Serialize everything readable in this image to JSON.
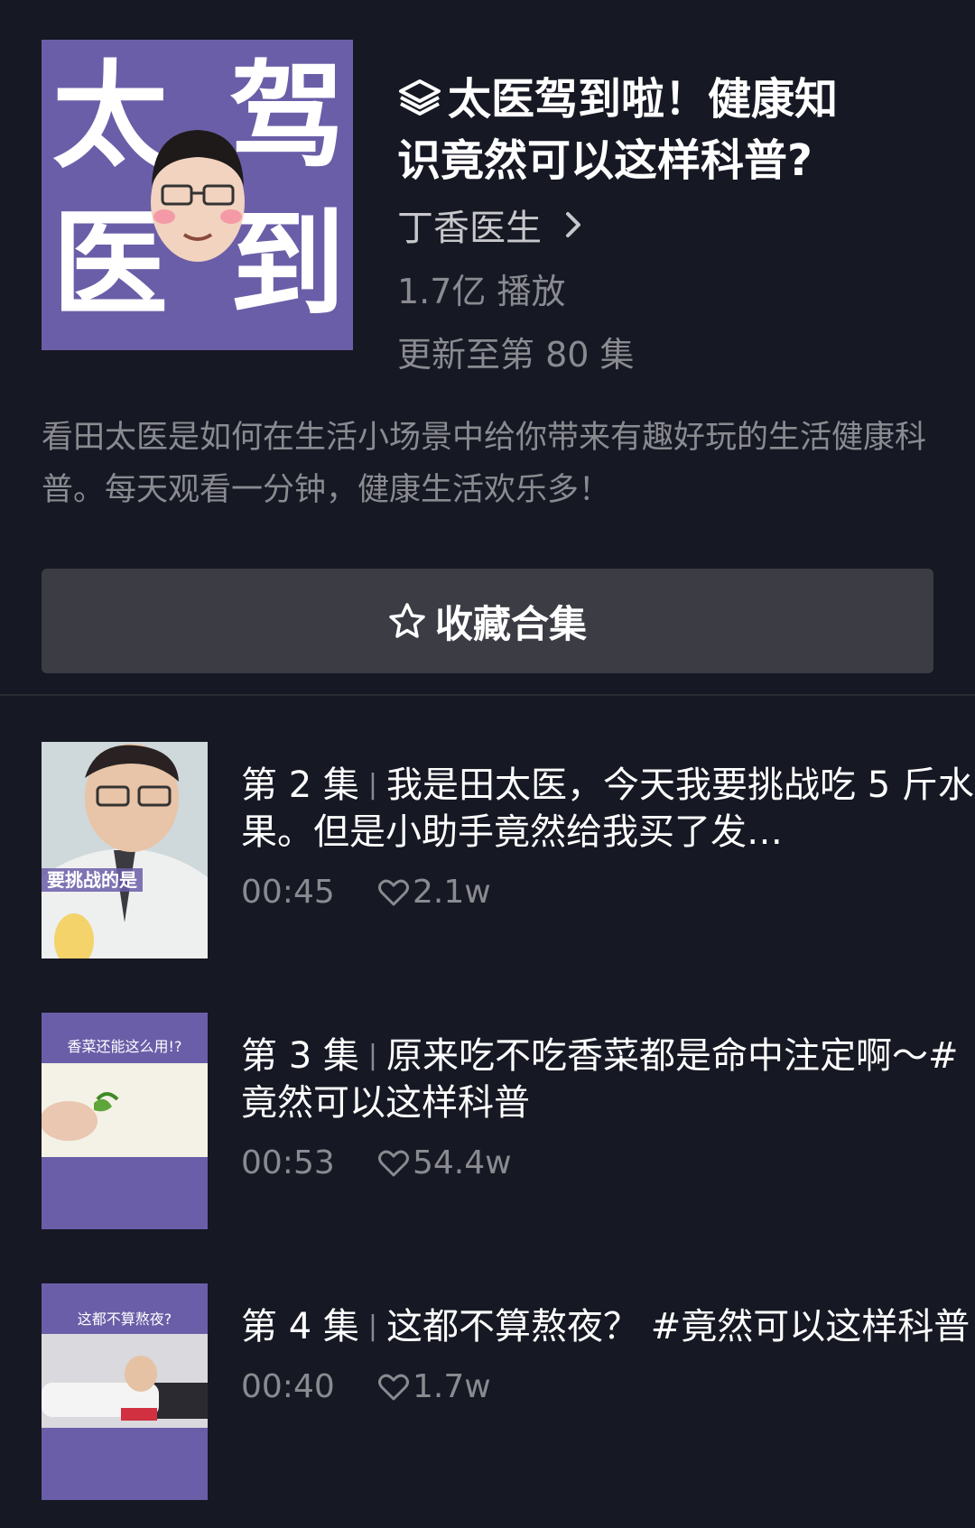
{
  "collection": {
    "cover_chars": [
      "太",
      "驾",
      "医",
      "到"
    ],
    "title": "太医驾到啦！健康知识竟然可以这样科普?",
    "title_line1": "太医驾到啦！健康知",
    "title_line2": "识竟然可以这样科普?",
    "author": "丁香医生",
    "plays": "1.7亿 播放",
    "update": "更新至第 80 集",
    "description": "看田太医是如何在生活小场景中给你带来有趣好玩的生活健康科普。每天观看一分钟，健康生活欢乐多！",
    "fav_label": "收藏合集",
    "accent": "#6b5ea8"
  },
  "episodes": [
    {
      "number": "第 2 集",
      "title": "我是田太医，今天我要挑战吃 5 斤水果。但是小助手竟然给我买了发…",
      "duration": "00:45",
      "likes": "2.1w",
      "thumb_caption": "要挑战的是"
    },
    {
      "number": "第 3 集",
      "title": "原来吃不吃香菜都是命中注定啊～#竟然可以这样科普",
      "duration": "00:53",
      "likes": "54.4w",
      "thumb_caption": "香菜还能这么用!?"
    },
    {
      "number": "第 4 集",
      "title": "这都不算熬夜？ #竟然可以这样科普",
      "duration": "00:40",
      "likes": "1.7w",
      "thumb_caption": "这都不算熬夜?"
    }
  ],
  "icons": {
    "title": "layers-icon",
    "author": "chevron-right-icon",
    "fav": "star-outline-icon",
    "likes": "heart-outline-icon"
  }
}
